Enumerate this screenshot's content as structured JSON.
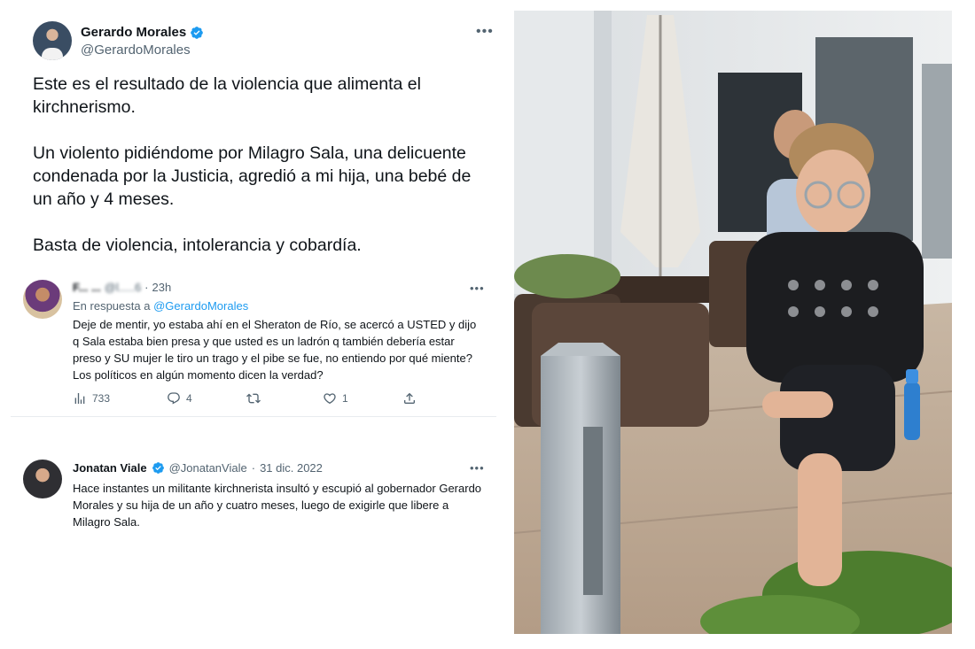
{
  "main_tweet": {
    "author_name": "Gerardo Morales",
    "author_handle": "@GerardoMorales",
    "more_icon": "more-horizontal-icon",
    "paragraphs": [
      "Este es el resultado de la violencia que alimenta el kirchnerismo.",
      "Un violento pidiéndome por Milagro Sala, una delicuente condenada por la Justicia, agredió a mi hija, una bebé de un año y 4 meses.",
      "Basta de violencia, intolerancia y cobardía."
    ]
  },
  "reply_tweet": {
    "author_name": "F... ...",
    "author_handle": "@l.....6",
    "time": "23h",
    "separator": "·",
    "replying_prefix": "En respuesta a",
    "replying_to": "@GerardoMorales",
    "text": "Deje de mentir, yo estaba ahí en el Sheraton de Río, se acercó a USTED y dijo q Sala estaba bien presa y que usted es un ladrón q también debería estar preso y SU mujer le tiro un trago y el pibe se fue, no entiendo por qué miente? Los políticos en algún momento dicen la verdad?",
    "actions": {
      "views": "733",
      "replies": "4",
      "retweets": "",
      "likes": "1"
    }
  },
  "quote_tweet": {
    "author_name": "Jonatan Viale",
    "author_handle": "@JonatanViale",
    "separator": "·",
    "date": "31 dic. 2022",
    "text": "Hace instantes un militante kirchnerista insultó y escupió al gobernador Gerardo Morales y su hija de un año y cuatro meses, luego de exigirle que libere a Milagro Sala."
  },
  "colors": {
    "verified_blue": "#1d9bf0",
    "link_blue": "#1d9bf0",
    "muted_gray": "#536471",
    "text_dark": "#0f1419"
  }
}
